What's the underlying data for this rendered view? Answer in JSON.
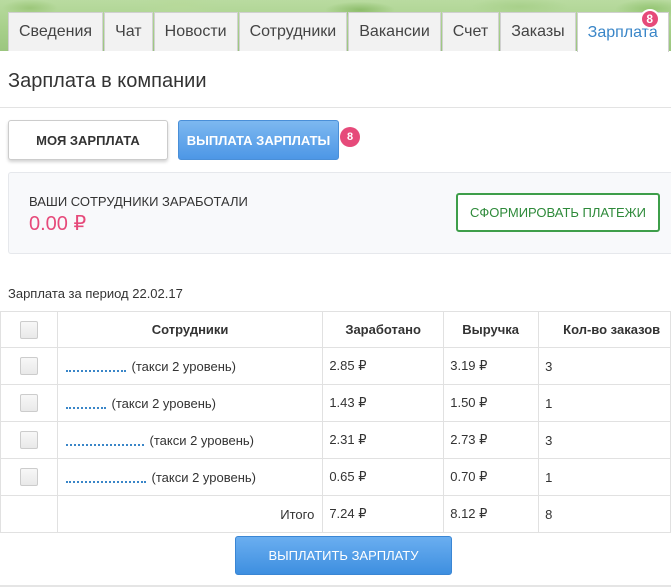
{
  "tabs": [
    {
      "label": "Сведения"
    },
    {
      "label": "Чат"
    },
    {
      "label": "Новости"
    },
    {
      "label": "Сотрудники"
    },
    {
      "label": "Вакансии"
    },
    {
      "label": "Счет"
    },
    {
      "label": "Заказы"
    },
    {
      "label": "Зарплата",
      "badge": "8",
      "active": true
    }
  ],
  "page_title": "Зарплата в компании",
  "buttons": {
    "my_salary": "МОЯ ЗАРПЛАТА",
    "salary_payout": "ВЫПЛАТА ЗАРПЛАТЫ",
    "salary_payout_badge": "8",
    "form_payments": "СФОРМИРОВАТЬ ПЛАТЕЖИ",
    "pay_salary": "ВЫПЛАТИТЬ ЗАРПЛАТУ"
  },
  "earnings": {
    "label": "ВАШИ СОТРУДНИКИ ЗАРАБОТАЛИ",
    "value": "0.00 ₽"
  },
  "period_text": "Зарплата за период 22.02.17",
  "table": {
    "headers": {
      "employees": "Сотрудники",
      "earned": "Заработано",
      "revenue": "Выручка",
      "orders": "Кол-во заказов"
    },
    "rows": [
      {
        "role": "(такси 2 уровень)",
        "earned": "2.85 ₽",
        "revenue": "3.19 ₽",
        "orders": "3"
      },
      {
        "role": "(такси 2 уровень)",
        "earned": "1.43 ₽",
        "revenue": "1.50 ₽",
        "orders": "1"
      },
      {
        "role": "(такси 2 уровень)",
        "earned": "2.31 ₽",
        "revenue": "2.73 ₽",
        "orders": "3"
      },
      {
        "role": "(такси 2 уровень)",
        "earned": "0.65 ₽",
        "revenue": "0.70 ₽",
        "orders": "1"
      }
    ],
    "total": {
      "label": "Итого",
      "earned": "7.24 ₽",
      "revenue": "8.12 ₽",
      "orders": "8"
    }
  },
  "colors": {
    "accent_blue": "#4d97e6",
    "badge_pink": "#e64a7a",
    "success_green": "#3e9e4a",
    "earnings_pink": "#e64a7a"
  }
}
